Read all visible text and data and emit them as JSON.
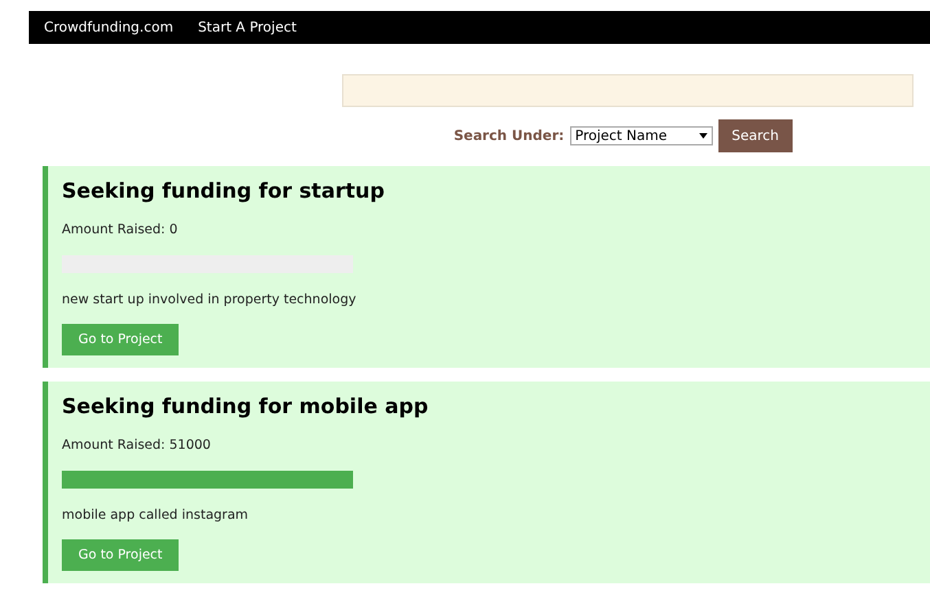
{
  "navbar": {
    "brand": "Crowdfunding.com",
    "links": [
      "Start A Project"
    ]
  },
  "search": {
    "label": "Search Under:",
    "select_value": "Project Name",
    "button": "Search"
  },
  "projects": [
    {
      "title": "Seeking funding for startup",
      "amount": "Amount Raised: 0",
      "level": 0,
      "description": "new start up involved in property technology",
      "button": "Go to Project"
    },
    {
      "title": "Seeking funding for mobile app",
      "amount": "Amount Raised: 51000",
      "level": 1,
      "description": "mobile app called instagram",
      "button": "Go to Project"
    }
  ]
}
